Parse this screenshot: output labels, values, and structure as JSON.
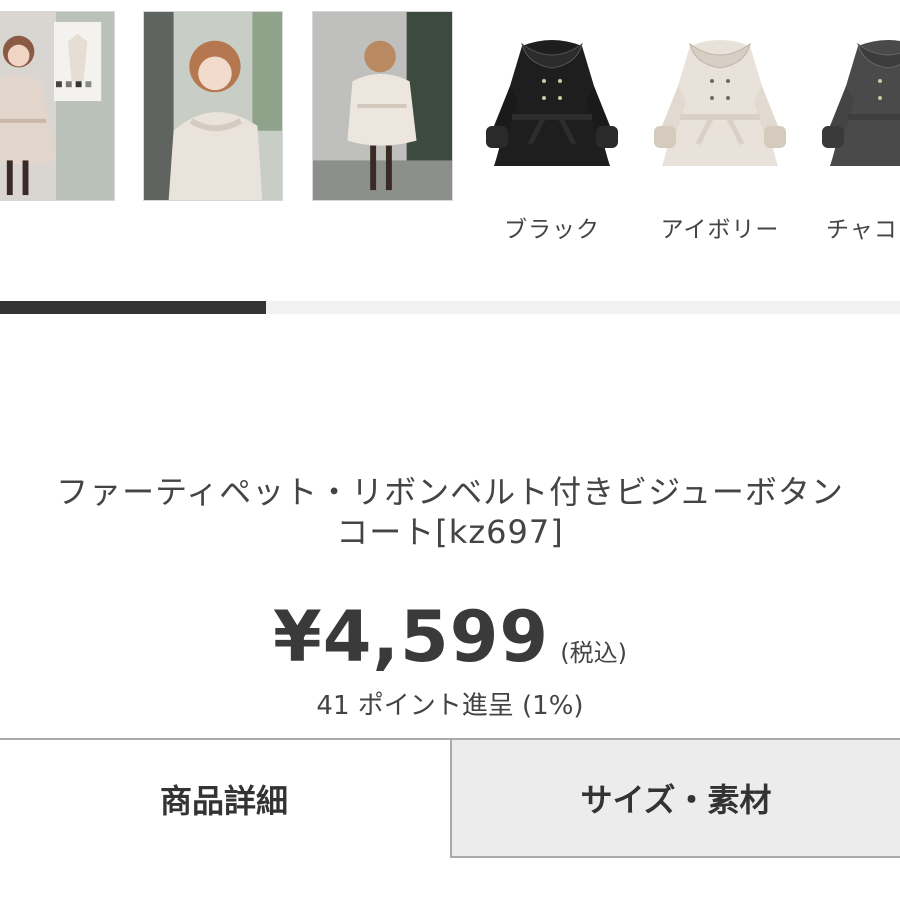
{
  "colors": {
    "accent": "#333333",
    "progress_track": "#f2f2f2",
    "inactive_tab": "#ececec",
    "swatch_black": "#1e1e1e",
    "swatch_ivory": "#e9e2da",
    "swatch_charcoal": "#4a4a4a"
  },
  "gallery": {
    "photos": [
      "model-photo-1",
      "model-photo-2",
      "model-photo-3"
    ],
    "swatches": [
      {
        "label": "ブラック",
        "icon": "coat-black"
      },
      {
        "label": "アイボリー",
        "icon": "coat-ivory"
      },
      {
        "label": "チャコ",
        "icon": "coat-charcoal"
      }
    ],
    "progress": 0.295
  },
  "product": {
    "title_line1": "ファーティペット・リボンベルト付きビジューボタン",
    "title_line2": "コート[kz697]",
    "price": "¥4,599",
    "tax_note": "(税込)",
    "points": "41 ポイント進呈 (1%)"
  },
  "tabs": [
    {
      "label": "商品詳細",
      "active": true
    },
    {
      "label": "サイズ・素材",
      "active": false
    }
  ]
}
